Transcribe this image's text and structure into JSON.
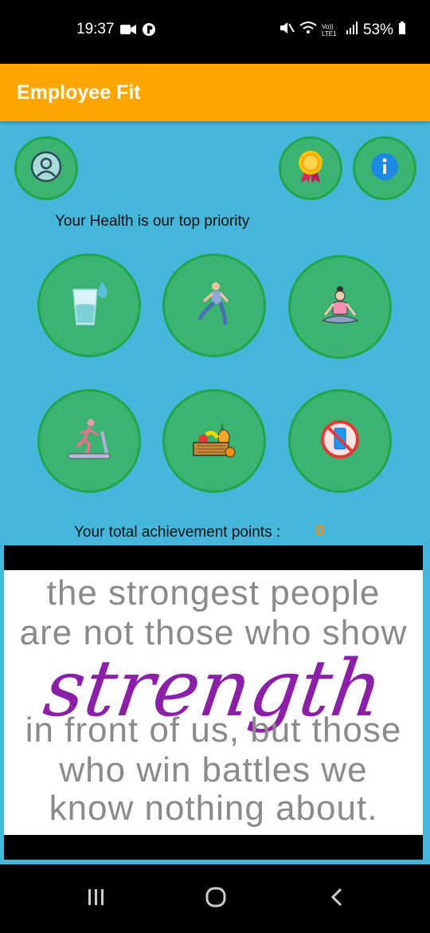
{
  "status_bar": {
    "time": "19:37",
    "battery": "53%",
    "network": "Vo)) LTE1"
  },
  "app": {
    "title": "Employee Fit",
    "accent": "#ffa500",
    "background": "#46b6da",
    "button_green": "#3cb371"
  },
  "top_icons": {
    "profile": "profile-avatar-icon",
    "award": "award-medal-icon",
    "info": "info-icon"
  },
  "tagline": "Your Health is our top priority",
  "activities": [
    {
      "icon": "water-glass-icon"
    },
    {
      "icon": "exercise-lunge-icon"
    },
    {
      "icon": "meditation-yoga-icon"
    },
    {
      "icon": "treadmill-running-icon"
    },
    {
      "icon": "fruit-basket-icon"
    },
    {
      "icon": "no-phone-icon"
    }
  ],
  "achievement": {
    "label": "Your total achievement points :",
    "value": "0"
  },
  "quote": {
    "line1": "the strongest people",
    "line2": "are not those who show",
    "emphasis": "strength",
    "line3": "in front of us, but those",
    "line4": "who win battles we",
    "line5": "know nothing about."
  }
}
